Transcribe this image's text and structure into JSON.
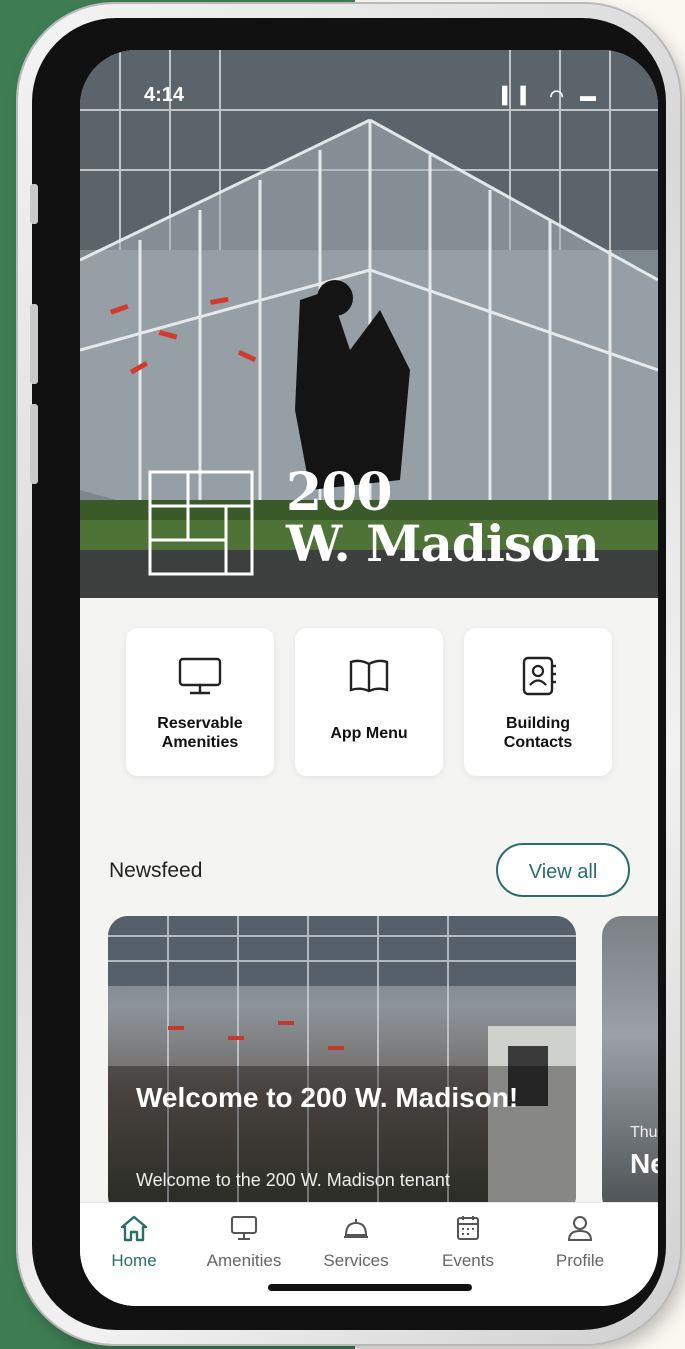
{
  "status_bar": {
    "time": "4:14",
    "signal": "▍▍ ∷ ▬"
  },
  "hero": {
    "logo_line1": "200",
    "logo_line2": "W. Madison"
  },
  "quick_actions": [
    {
      "label": "Reservable\nAmenities",
      "icon": "monitor-icon"
    },
    {
      "label": "App Menu",
      "icon": "book-icon"
    },
    {
      "label": "Building\nContacts",
      "icon": "contacts-book-icon"
    }
  ],
  "newsfeed": {
    "title": "Newsfeed",
    "view_all": "View all",
    "cards": [
      {
        "title": "Welcome to 200 W. Madison!",
        "subtitle": "Welcome to the 200 W. Madison tenant"
      },
      {
        "day": "Thu",
        "title": "Ne"
      }
    ]
  },
  "tabbar": {
    "tabs": [
      {
        "label": "Home",
        "icon": "home-icon",
        "active": true
      },
      {
        "label": "Amenities",
        "icon": "monitor-icon",
        "active": false
      },
      {
        "label": "Services",
        "icon": "service-bell-icon",
        "active": false
      },
      {
        "label": "Events",
        "icon": "calendar-icon",
        "active": false
      },
      {
        "label": "Profile",
        "icon": "person-icon",
        "active": false
      }
    ]
  },
  "colors": {
    "accent": "#2a6e67",
    "background_green": "#3e7d52",
    "background_cream": "#fbf8f1"
  }
}
